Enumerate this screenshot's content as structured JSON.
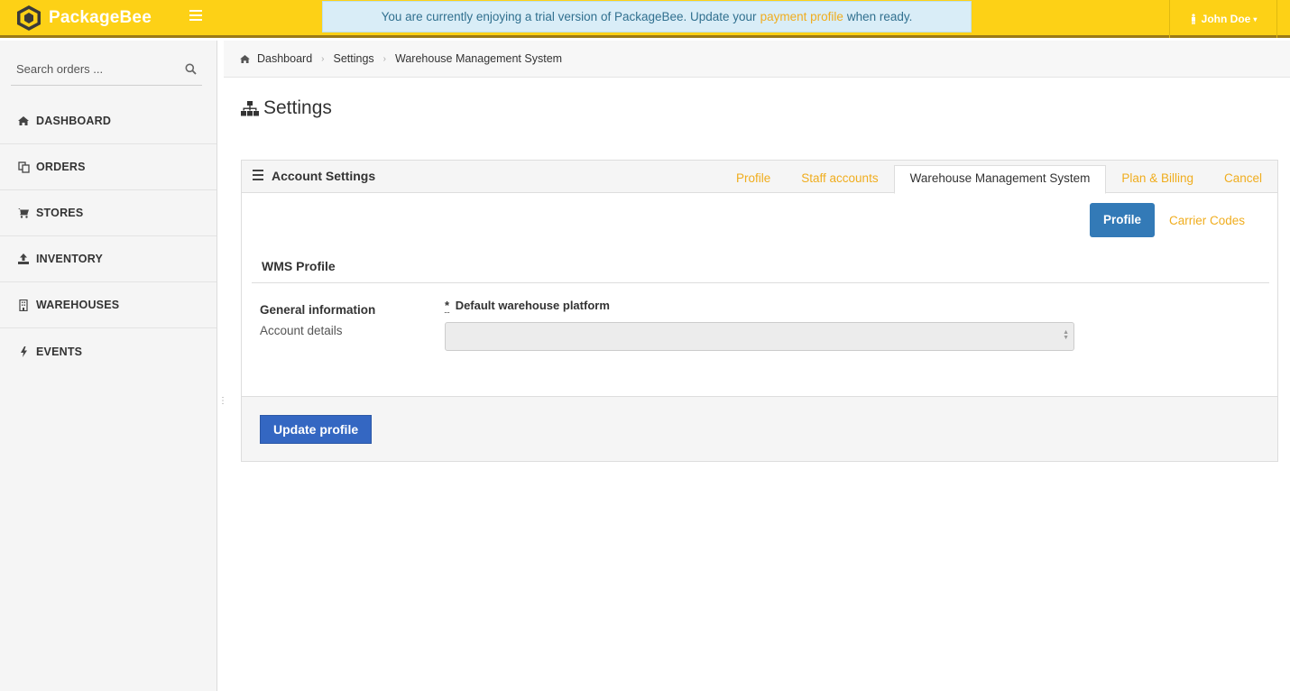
{
  "brand": {
    "name": "PackageBee",
    "logo_icon": "hexagon-bee-logo"
  },
  "topbar": {
    "menu_icon": "hamburger-icon",
    "trial": {
      "prefix": "You are currently enjoying a trial version of PackageBee. Update your",
      "link": "payment profile",
      "suffix": "when ready."
    },
    "user": {
      "name": "John Doe",
      "icon": "user-icon",
      "caret": "▾"
    }
  },
  "sidebar": {
    "search_placeholder": "Search orders ...",
    "items": [
      {
        "label": "DASHBOARD",
        "icon": "home-icon"
      },
      {
        "label": "ORDERS",
        "icon": "copy-icon"
      },
      {
        "label": "STORES",
        "icon": "cart-icon"
      },
      {
        "label": "INVENTORY",
        "icon": "upload-icon"
      },
      {
        "label": "WAREHOUSES",
        "icon": "building-icon"
      },
      {
        "label": "EVENTS",
        "icon": "bolt-icon"
      }
    ]
  },
  "breadcrumb": [
    "Dashboard",
    "Settings",
    "Warehouse Management System"
  ],
  "page": {
    "title": "Settings",
    "title_icon": "sitemap-icon"
  },
  "panel": {
    "title": "Account Settings",
    "tabs": [
      "Profile",
      "Staff accounts",
      "Warehouse Management System",
      "Plan & Billing",
      "Cancel"
    ],
    "active_tab": "Warehouse Management System",
    "subtabs": {
      "active": "Profile",
      "other": "Carrier Codes"
    },
    "section_title": "WMS Profile",
    "group_label": "General information",
    "group_sub": "Account details",
    "field": {
      "required_mark": "*",
      "label": "Default warehouse platform",
      "value": ""
    },
    "submit_label": "Update profile"
  },
  "colors": {
    "topbar": "#fdd116",
    "accent": "#f0ad1e",
    "primary": "#337ab7",
    "submit": "#3467c2"
  }
}
